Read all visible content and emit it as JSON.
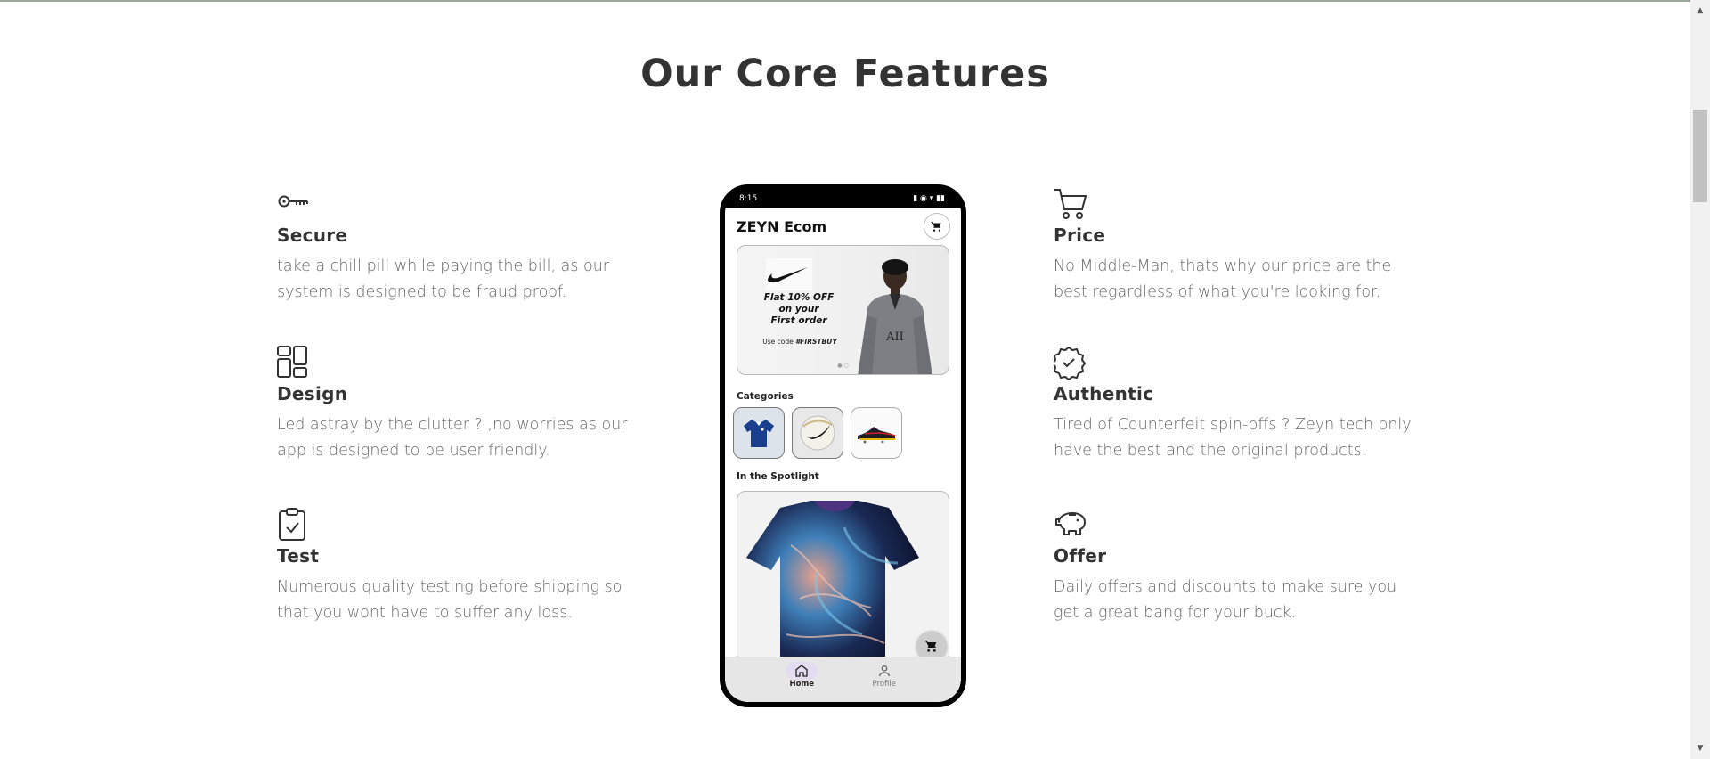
{
  "page": {
    "title": "Our Core Features"
  },
  "features_left": [
    {
      "icon": "key-icon",
      "title": "Secure",
      "text": "take a chill pill while paying the bill, as our system is designed to be fraud proof."
    },
    {
      "icon": "grid-layout-icon",
      "title": "Design",
      "text": "Led astray by the clutter ? ,no worries as our app is designed to be user friendly."
    },
    {
      "icon": "clipboard-check-icon",
      "title": "Test",
      "text": "Numerous quality testing before shipping so that you wont have to suffer any loss."
    }
  ],
  "features_right": [
    {
      "icon": "cart-icon",
      "title": "Price",
      "text": "No Middle-Man, thats why our price are the best regardless of what you're looking for."
    },
    {
      "icon": "verified-badge-icon",
      "title": "Authentic",
      "text": "Tired of Counterfeit spin-offs ? Zeyn tech only have the best and the original products."
    },
    {
      "icon": "piggy-bank-icon",
      "title": "Offer",
      "text": "Daily offers and discounts to make sure you get a great bang for your buck."
    }
  ],
  "phone": {
    "time": "8:15",
    "app_title": "ZEYN Ecom",
    "banner": {
      "offer_line1": "Flat 10% OFF",
      "offer_line2": "on your",
      "offer_line3": "First order",
      "code_prefix": "Use code ",
      "code": "#FIRSTBUY"
    },
    "categories_label": "Categories",
    "spotlight_label": "In the Spotlight",
    "nav": {
      "home": "Home",
      "profile": "Profile"
    }
  },
  "colors": {
    "heading": "#333333",
    "body_text": "#666666",
    "phone_frame": "#000000",
    "nav_active": "#e4dcf1"
  }
}
